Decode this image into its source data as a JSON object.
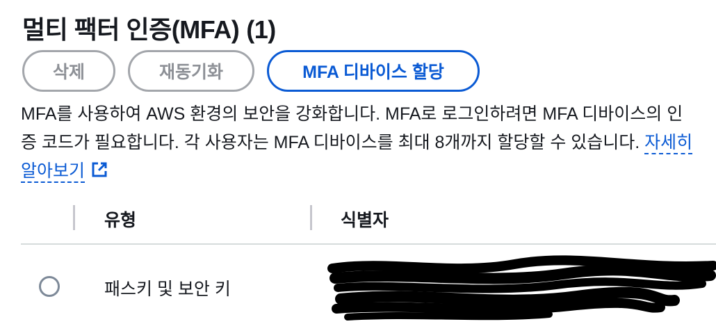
{
  "header": {
    "title": "멀티 팩터 인증(MFA)",
    "count": "(1)"
  },
  "actions": {
    "delete_label": "삭제",
    "deactivate_label": "재동기화",
    "assign_label": "MFA 디바이스 할당"
  },
  "description": {
    "text": "MFA를 사용하여 AWS 환경의 보안을 강화합니다. MFA로 로그인하려면 MFA 디바이스의 인증 코드가 필요합니다. 각 사용자는 MFA 디바이스를 최대 8개까지 할당할 수 있습니다.",
    "link_label": "자세히 알아보기",
    "link_icon": "external-link-icon"
  },
  "table": {
    "columns": [
      "유형",
      "식별자"
    ],
    "rows": [
      {
        "type": "패스키 및 보안 키",
        "selected": false
      }
    ]
  },
  "colors": {
    "primary": "#0a5ad4",
    "disabled_border": "#a3a6ab",
    "disabled_text": "#8d9096",
    "text": "#16191f"
  }
}
